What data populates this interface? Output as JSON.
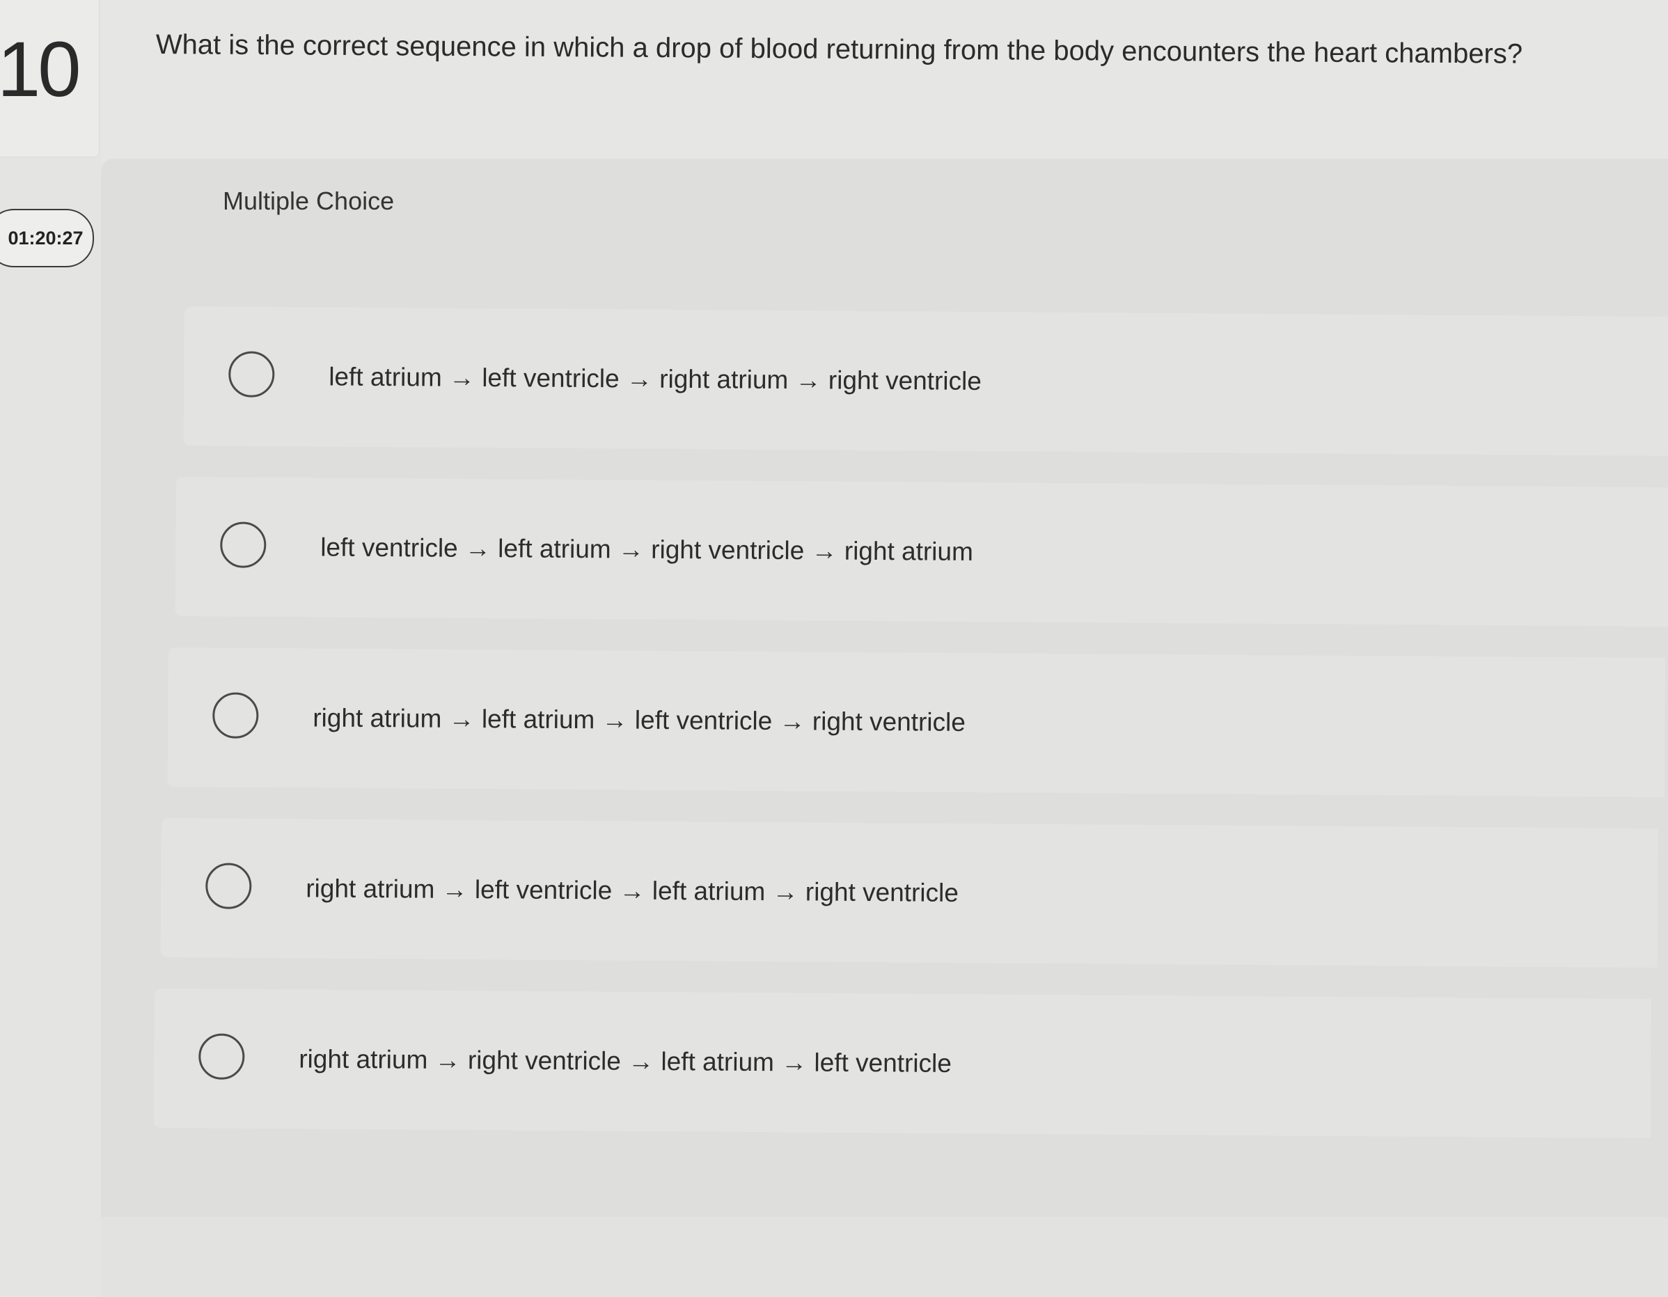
{
  "question": {
    "number": "10",
    "text": "What is the correct sequence in which a drop of blood returning from the body encounters the heart chambers?"
  },
  "timer": {
    "value": "01:20:27"
  },
  "answer_area": {
    "type_label": "Multiple Choice",
    "choices": [
      {
        "label": "left atrium → left ventricle → right atrium → right ventricle",
        "selected": false
      },
      {
        "label": "left ventricle → left atrium → right ventricle → right atrium",
        "selected": false
      },
      {
        "label": "right atrium → left atrium → left ventricle → right ventricle",
        "selected": false
      },
      {
        "label": "right atrium → left ventricle → left atrium → right ventricle",
        "selected": false
      },
      {
        "label": "right atrium → right ventricle → left atrium → left ventricle",
        "selected": false
      }
    ]
  }
}
